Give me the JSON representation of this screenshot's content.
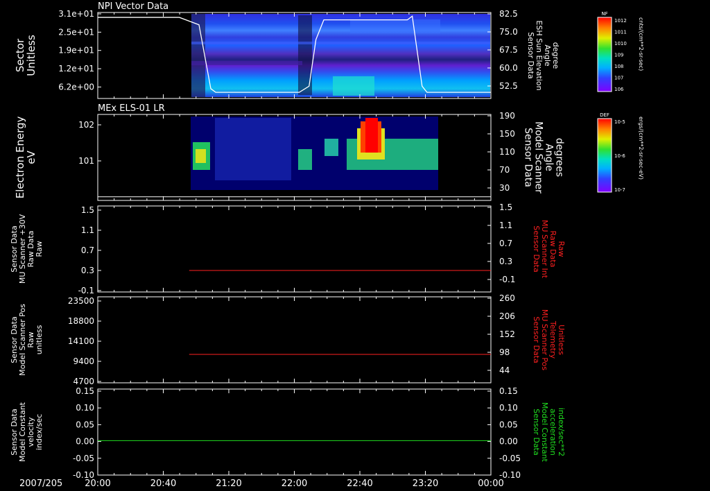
{
  "date_label": "2007/205",
  "time_ticks": [
    "20:00",
    "20:40",
    "21:20",
    "22:00",
    "22:40",
    "23:20",
    "00:00"
  ],
  "colors": {
    "white": "#ffffff",
    "red": "#ff2020",
    "green": "#20e020",
    "frame": "#ffffff"
  },
  "chart_data": [
    {
      "type": "heatmap",
      "title": "NPI Vector Data",
      "ylabel_left": [
        "Sector",
        "Unitless"
      ],
      "yticks_left": [
        "3.1e+01",
        "2.5e+01",
        "1.9e+01",
        "1.2e+01",
        "6.2e+00"
      ],
      "ylabel_right": [
        "Sensor Data",
        "ESH Sun Elevation",
        "Angle",
        "degree"
      ],
      "yticks_right": [
        "82.5",
        "75.0",
        "67.5",
        "60.0",
        "52.5"
      ],
      "overlay_line": {
        "name": "ESH Sun Elevation Angle",
        "color": "#ffffff",
        "x_hours": [
          0,
          0.83,
          1.03,
          1.15,
          1.2,
          2.05,
          2.15,
          2.22,
          2.3,
          3.15,
          3.2,
          3.3,
          3.35,
          4.0
        ],
        "y": [
          81,
          81,
          78,
          52,
          50.5,
          50.5,
          53,
          72,
          80,
          80,
          81.5,
          53,
          50.5,
          50.5
        ],
        "ylim": [
          48,
          83
        ]
      },
      "colorbar": {
        "label": "NF",
        "units": "cnts/(cm**2-sr-sec)",
        "ticks": [
          "10^12",
          "10^11",
          "10^10",
          "10^9",
          "10^8",
          "10^7",
          "10^6"
        ]
      },
      "data_span_hours": [
        0.98,
        4.0
      ]
    },
    {
      "type": "heatmap",
      "title": "MEx ELS-01 LR",
      "ylabel_left": [
        "Electron Energy",
        "eV"
      ],
      "yticks_left": [
        "10^2",
        "10^1"
      ],
      "ylabel_right": [
        "Sensor Data",
        "Model Scanner",
        "Angle",
        "degrees"
      ],
      "yticks_right": [
        "190",
        "150",
        "110",
        "70",
        "30"
      ],
      "overlay_line": {
        "name": "Model Scanner Angle",
        "color": "#ffffff",
        "value": 8,
        "ylim": [
          0,
          190
        ]
      },
      "colorbar": {
        "label": "DEF",
        "units": "ergs/(cm**2-sr-sec-eV)",
        "ticks": [
          "10^-5",
          "10^-6",
          "10^-7"
        ]
      },
      "data_span_hours": [
        0.98,
        3.5
      ]
    },
    {
      "type": "line",
      "ylabel_left": [
        "Sensor Data",
        "MU Scanner +30V",
        "Raw Data",
        "Raw"
      ],
      "yticks_left": [
        "1.5",
        "1.1",
        "0.7",
        "0.3",
        "-0.1"
      ],
      "ylim_left": [
        -0.5,
        1.5
      ],
      "ylabel_right": [
        "Sensor Data",
        "MU Scanner Int",
        "Raw Data",
        "Raw"
      ],
      "yticks_right": [
        "1.5",
        "1.1",
        "0.7",
        "0.3",
        "-0.1"
      ],
      "series": [
        {
          "name": "MU Scanner Int Raw Data",
          "color": "#ff2020",
          "x_hours": [
            0.93,
            4.0
          ],
          "y": [
            -0.0,
            -0.0
          ]
        }
      ]
    },
    {
      "type": "line",
      "ylabel_left": [
        "Sensor Data",
        "Model Scanner Pos",
        "Raw",
        "unitless"
      ],
      "yticks_left": [
        "23500",
        "18800",
        "14100",
        "9400",
        "4700"
      ],
      "ylabel_right": [
        "Sensor Data",
        "MU Scanner Pos",
        "Telemetry",
        "Unitless"
      ],
      "yticks_right": [
        "260",
        "206",
        "152",
        "98",
        "44"
      ],
      "ylim_right": [
        0,
        260
      ],
      "series": [
        {
          "name": "MU Scanner Pos Telemetry",
          "color": "#ff2020",
          "x_hours": [
            0.93,
            4.0
          ],
          "y": [
            86,
            86
          ]
        }
      ]
    },
    {
      "type": "line",
      "ylabel_left": [
        "Sensor Data",
        "Model Constant",
        "velocity",
        "index/sec"
      ],
      "yticks_left": [
        "0.15",
        "0.10",
        "0.05",
        "0.00",
        "-0.05",
        "-0.10"
      ],
      "ylim_left": [
        -0.1,
        0.15
      ],
      "ylabel_right": [
        "Sensor Data",
        "Model Constant",
        "acceleration",
        "index/sec**2"
      ],
      "yticks_right": [
        "0.15",
        "0.10",
        "0.05",
        "0.00",
        "-0.05",
        "-0.10"
      ],
      "series": [
        {
          "name": "Model Constant acceleration",
          "color": "#20e020",
          "x_hours": [
            0,
            4.0
          ],
          "y": [
            0,
            0
          ]
        }
      ]
    }
  ]
}
